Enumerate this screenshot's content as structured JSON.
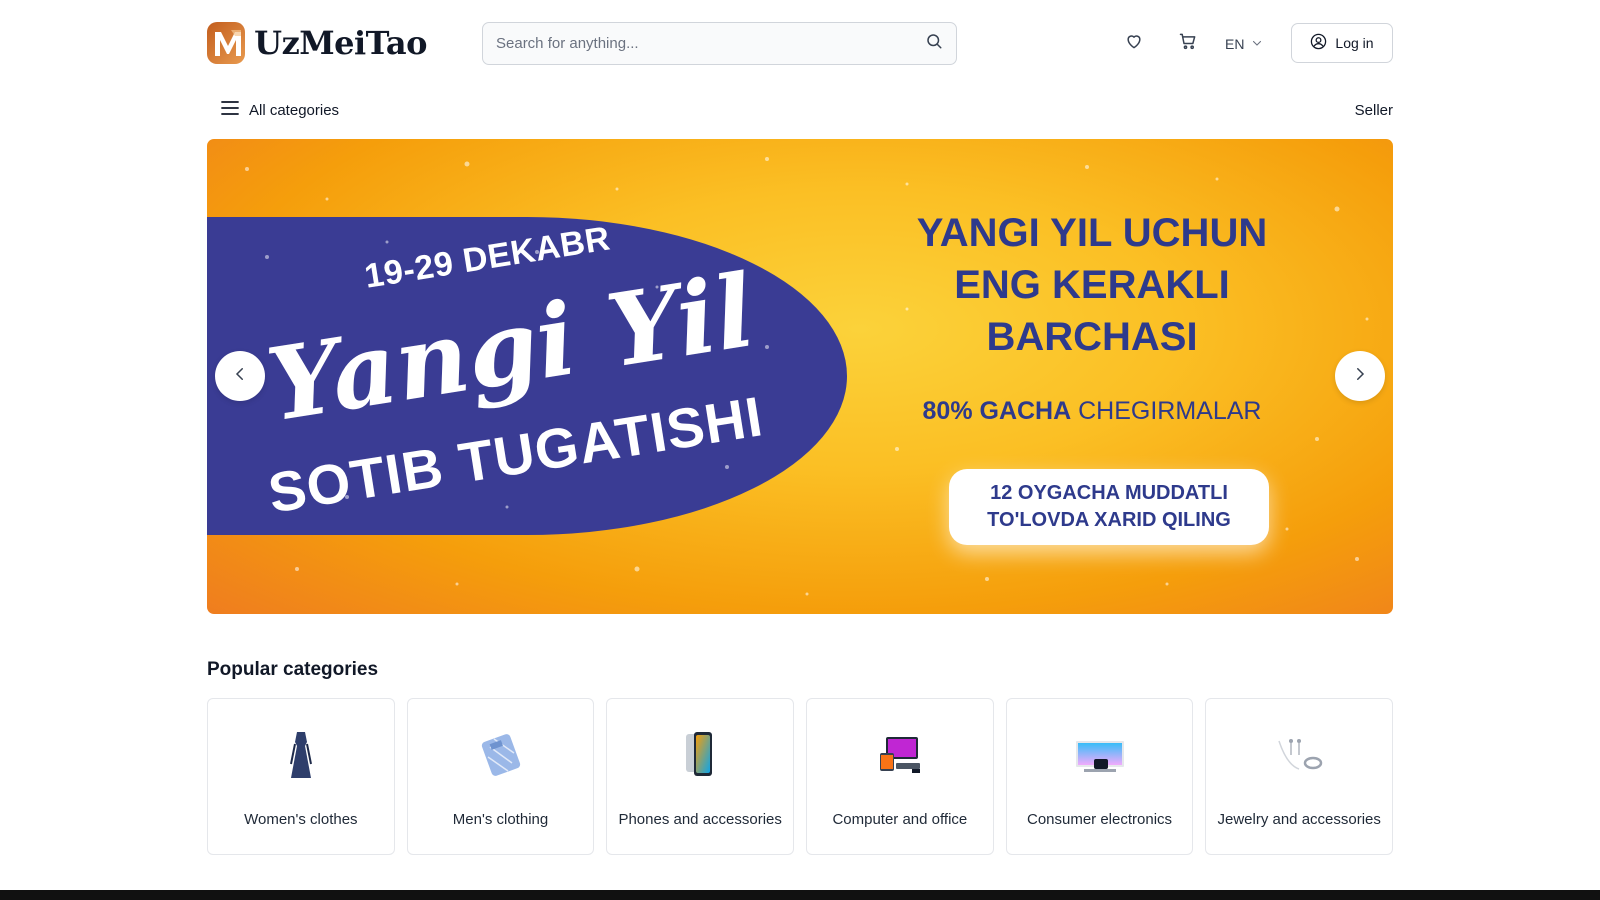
{
  "header": {
    "brand_name": "UzMeiTao",
    "logo_letter": "M",
    "search_placeholder": "Search for anything...",
    "language": "EN",
    "login_label": "Log in"
  },
  "nav": {
    "all_categories_label": "All categories",
    "seller_label": "Seller"
  },
  "banner": {
    "date": "19-29 DEKABR",
    "script_title": "Yangi Yil",
    "subtitle": "SOTIB TUGATISHI",
    "headline_line1": "YANGI YIL UCHUN",
    "headline_line2": "ENG KERAKLI",
    "headline_line3": "BARCHASI",
    "discount_bold": "80% GACHA",
    "discount_rest": " CHEGIRMALAR",
    "cta_line1": "12 OYGACHA MUDDATLI",
    "cta_line2": "TO'LOVDA XARID QILING",
    "colors": {
      "navy": "#3a3c94",
      "text_navy": "#2e3a8c",
      "orange": "#f59e0b",
      "yellow": "#fbd23a"
    }
  },
  "popular": {
    "title": "Popular categories",
    "items": [
      {
        "label": "Women's clothes",
        "icon": "dress-icon"
      },
      {
        "label": "Men's clothing",
        "icon": "shirt-icon"
      },
      {
        "label": "Phones and accessories",
        "icon": "phone-icon"
      },
      {
        "label": "Computer and office",
        "icon": "computer-icon"
      },
      {
        "label": "Consumer electronics",
        "icon": "tv-icon"
      },
      {
        "label": "Jewelry and accessories",
        "icon": "jewelry-icon"
      }
    ]
  }
}
